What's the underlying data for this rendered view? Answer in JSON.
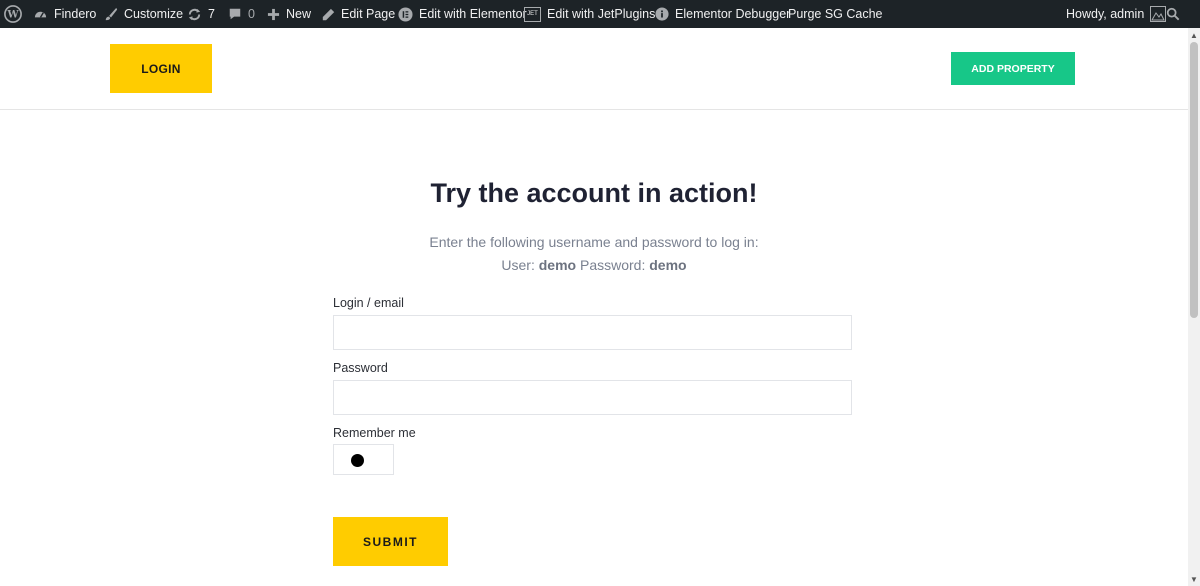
{
  "admin_bar": {
    "site_name": "Findero",
    "customize": "Customize",
    "updates_count": "7",
    "comments_count": "0",
    "new": "New",
    "edit_page": "Edit Page",
    "edit_elementor": "Edit with Elementor",
    "edit_jetplugins": "Edit with JetPlugins",
    "jet_badge": "JET",
    "elementor_debugger": "Elementor Debugger",
    "purge_cache": "Purge SG Cache",
    "howdy": "Howdy, admin",
    "icons": [
      "wordpress-icon",
      "dashboard-icon",
      "brush-icon",
      "updates-icon",
      "comment-icon",
      "plus-icon",
      "pencil-icon",
      "elementor-icon",
      "jet-icon",
      "info-icon",
      "avatar",
      "search-icon"
    ]
  },
  "header": {
    "login_label": "LOGIN",
    "add_property_label": "ADD PROPERTY"
  },
  "main": {
    "title": "Try the account in action!",
    "intro_line": "Enter the following username and password to log in:",
    "user_label": "User:",
    "user_value": "demo",
    "password_label": "Password:",
    "password_value": "demo"
  },
  "form": {
    "login_label": "Login / email",
    "login_value": "",
    "password_label": "Password",
    "password_value": "",
    "remember_label": "Remember me",
    "remember_checked": true,
    "submit_label": "SUBMIT"
  },
  "colors": {
    "admin_bar_bg": "#1d2327",
    "accent_yellow": "#ffcc00",
    "accent_green": "#17c788",
    "title_color": "#1f2233",
    "muted_text": "#7a8190"
  }
}
